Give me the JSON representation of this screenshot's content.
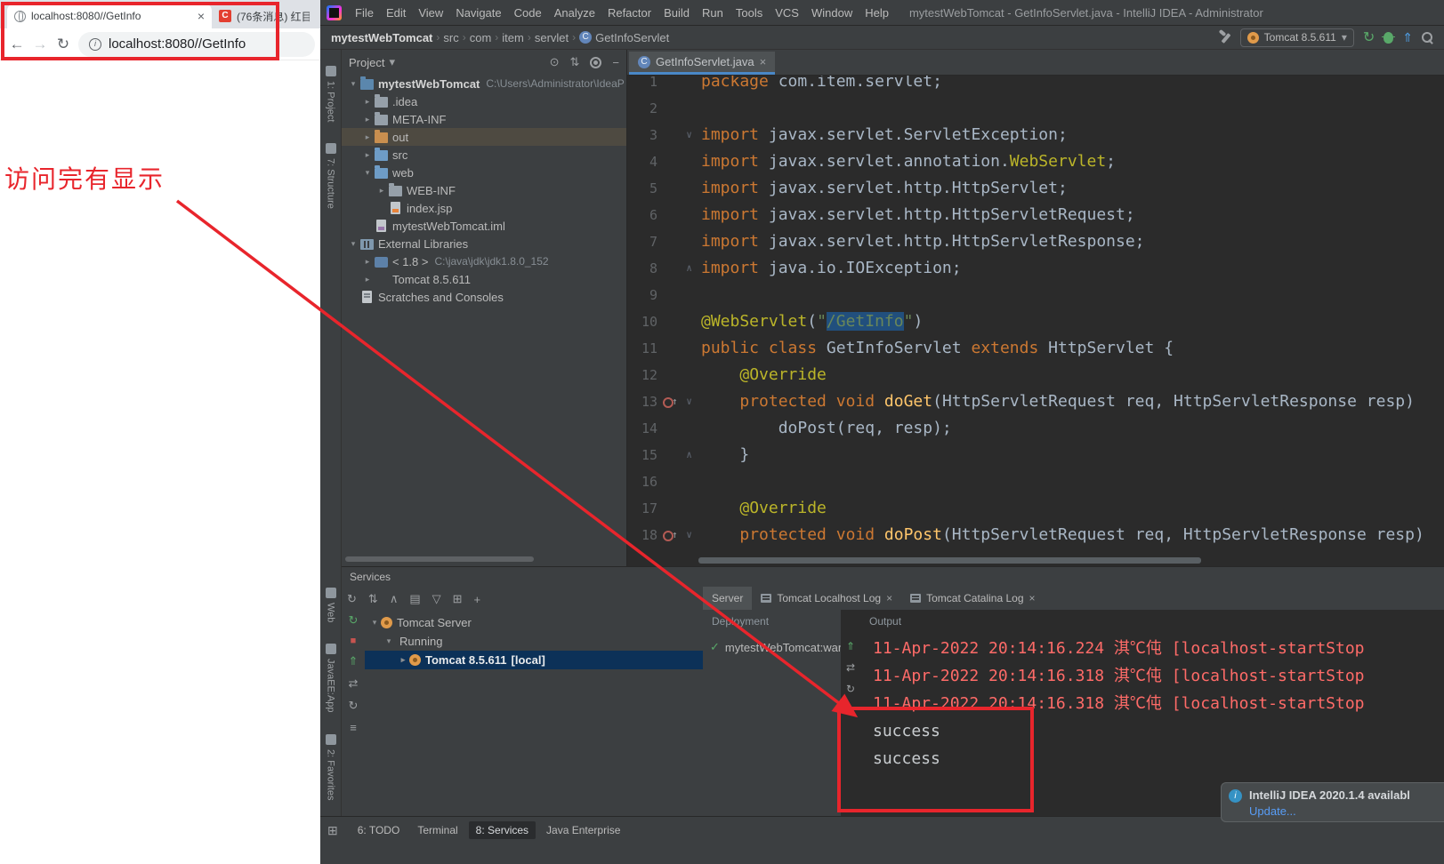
{
  "colors": {
    "annotation_red": "#e8252c",
    "selection_blue": "#214f7d",
    "log_error_red": "#ff6b68",
    "accent_tab_underline": "#4a88c7"
  },
  "annotations": {
    "note": "访问完有显示"
  },
  "browser": {
    "tabs": [
      {
        "title": "localhost:8080//GetInfo",
        "active": true
      },
      {
        "title": "(76条消息) 红目",
        "favicon_letter": "C",
        "active": false
      }
    ],
    "url": "localhost:8080//GetInfo"
  },
  "idea": {
    "window_title": "mytestWebTomcat - GetInfoServlet.java - IntelliJ IDEA - Administrator",
    "menus": [
      "File",
      "Edit",
      "View",
      "Navigate",
      "Code",
      "Analyze",
      "Refactor",
      "Build",
      "Run",
      "Tools",
      "VCS",
      "Window",
      "Help"
    ],
    "breadcrumbs": [
      "mytestWebTomcat",
      "src",
      "com",
      "item",
      "servlet",
      "GetInfoServlet"
    ],
    "run_config": "Tomcat 8.5.611",
    "tool_stripe": [
      {
        "id": "project",
        "label": "1: Project",
        "group": "top"
      },
      {
        "id": "structure",
        "label": "7: Structure",
        "group": "top"
      },
      {
        "id": "web",
        "label": "Web",
        "group": "bottom"
      },
      {
        "id": "javaee-app",
        "label": "JavaEE:App",
        "group": "bottom"
      },
      {
        "id": "favorites",
        "label": "2: Favorites",
        "group": "bottom"
      }
    ],
    "project": {
      "title": "Project",
      "tree": [
        {
          "label": "mytestWebTomcat",
          "path": "C:\\Users\\Administrator\\IdeaP",
          "arrow": "▾",
          "icon": "project",
          "bold": true,
          "indent": 0
        },
        {
          "label": ".idea",
          "arrow": "▸",
          "icon": "folder",
          "indent": 1
        },
        {
          "label": "META-INF",
          "arrow": "▸",
          "icon": "folder",
          "indent": 1
        },
        {
          "label": "out",
          "arrow": "▸",
          "icon": "folder-out",
          "indent": 1,
          "sel": true
        },
        {
          "label": "src",
          "arrow": "▸",
          "icon": "folder-src",
          "indent": 1
        },
        {
          "label": "web",
          "arrow": "▾",
          "icon": "folder-web",
          "indent": 1
        },
        {
          "label": "WEB-INF",
          "arrow": "▸",
          "icon": "folder",
          "indent": 2
        },
        {
          "label": "index.jsp",
          "icon": "jsp",
          "indent": 2
        },
        {
          "label": "mytestWebTomcat.iml",
          "icon": "iml",
          "indent": 1
        },
        {
          "label": "External Libraries",
          "arrow": "▾",
          "icon": "libs",
          "indent": 0
        },
        {
          "label": "< 1.8 >",
          "path": "C:\\java\\jdk\\jdk1.8.0_152",
          "arrow": "▸",
          "icon": "jdk",
          "indent": 1
        },
        {
          "label": "Tomcat 8.5.611",
          "arrow": "▸",
          "icon": "tomcat",
          "indent": 1
        },
        {
          "label": "Scratches and Consoles",
          "icon": "scratch",
          "indent": 0
        }
      ]
    },
    "editor": {
      "tab": "GetInfoServlet.java",
      "lines": [
        {
          "n": 1,
          "tokens": [
            [
              "k",
              "package"
            ],
            [
              "p",
              " com.item.servlet;"
            ]
          ]
        },
        {
          "n": 2,
          "tokens": []
        },
        {
          "n": 3,
          "fold": "v",
          "tokens": [
            [
              "k",
              "import"
            ],
            [
              "p",
              " javax.servlet.ServletException;"
            ]
          ]
        },
        {
          "n": 4,
          "tokens": [
            [
              "k",
              "import"
            ],
            [
              "p",
              " javax.servlet.annotation."
            ],
            [
              "a",
              "WebServlet"
            ],
            [
              "p",
              ";"
            ]
          ]
        },
        {
          "n": 5,
          "tokens": [
            [
              "k",
              "import"
            ],
            [
              "p",
              " javax.servlet.http.HttpServlet;"
            ]
          ]
        },
        {
          "n": 6,
          "tokens": [
            [
              "k",
              "import"
            ],
            [
              "p",
              " javax.servlet.http.HttpServletRequest;"
            ]
          ]
        },
        {
          "n": 7,
          "tokens": [
            [
              "k",
              "import"
            ],
            [
              "p",
              " javax.servlet.http.HttpServletResponse;"
            ]
          ]
        },
        {
          "n": 8,
          "fold": "c",
          "tokens": [
            [
              "k",
              "import"
            ],
            [
              "p",
              " java.io.IOException;"
            ]
          ]
        },
        {
          "n": 9,
          "tokens": []
        },
        {
          "n": 10,
          "tokens": [
            [
              "a",
              "@WebServlet"
            ],
            [
              "p",
              "("
            ],
            [
              "s",
              "\""
            ],
            [
              "ssel",
              "/GetInfo"
            ],
            [
              "s",
              "\""
            ],
            [
              "p",
              ")"
            ]
          ]
        },
        {
          "n": 11,
          "tokens": [
            [
              "k",
              "public class "
            ],
            [
              "p",
              "GetInfoServlet "
            ],
            [
              "k",
              "extends"
            ],
            [
              "p",
              " HttpServlet {"
            ]
          ]
        },
        {
          "n": 12,
          "tokens": [
            [
              "p",
              "    "
            ],
            [
              "a",
              "@Override"
            ]
          ]
        },
        {
          "n": 13,
          "fold": "v",
          "override": true,
          "tokens": [
            [
              "p",
              "    "
            ],
            [
              "k",
              "protected void "
            ],
            [
              "m",
              "doGet"
            ],
            [
              "p",
              "(HttpServletRequest req, HttpServletResponse resp)"
            ]
          ]
        },
        {
          "n": 14,
          "tokens": [
            [
              "p",
              "        doPost(req, resp);"
            ]
          ]
        },
        {
          "n": 15,
          "fold": "c",
          "tokens": [
            [
              "p",
              "    }"
            ]
          ]
        },
        {
          "n": 16,
          "tokens": []
        },
        {
          "n": 17,
          "tokens": [
            [
              "p",
              "    "
            ],
            [
              "a",
              "@Override"
            ]
          ]
        },
        {
          "n": 18,
          "fold": "v",
          "override": true,
          "tokens": [
            [
              "p",
              "    "
            ],
            [
              "k",
              "protected void "
            ],
            [
              "m",
              "doPost"
            ],
            [
              "p",
              "(HttpServletRequest req, HttpServletResponse resp)"
            ]
          ]
        }
      ]
    },
    "services": {
      "title": "Services",
      "tree": [
        {
          "label": "Tomcat Server",
          "arrow": "▾",
          "icon": "tomcat",
          "indent": 0
        },
        {
          "label": "Running",
          "arrow": "▾",
          "indent": 1
        },
        {
          "label": "Tomcat 8.5.611",
          "suffix": "[local]",
          "arrow": "▸",
          "icon": "tomcat",
          "indent": 2,
          "selected": true
        }
      ],
      "tabs": [
        {
          "label": "Server",
          "active": true
        },
        {
          "label": "Tomcat Localhost Log",
          "closable": true
        },
        {
          "label": "Tomcat Catalina Log",
          "closable": true
        }
      ],
      "deployment": {
        "header": "Deployment",
        "item": "mytestWebTomcat:war"
      },
      "output": {
        "header": "Output",
        "lines": [
          {
            "text": "11-Apr-2022 20:14:16.224 淇℃伅 [localhost-startStop",
            "kind": "error"
          },
          {
            "text": "11-Apr-2022 20:14:16.318 淇℃伅 [localhost-startStop",
            "kind": "error"
          },
          {
            "text": "11-Apr-2022 20:14:16.318 淇℃伅 [localhost-startStop",
            "kind": "error"
          },
          {
            "text": "success",
            "kind": "plain"
          },
          {
            "text": "success",
            "kind": "plain"
          }
        ]
      }
    },
    "status_bar": {
      "items": [
        {
          "label": "6: TODO"
        },
        {
          "label": "Terminal"
        },
        {
          "label": "8: Services",
          "active": true
        },
        {
          "label": "Java Enterprise"
        }
      ]
    },
    "notification": {
      "title": "IntelliJ IDEA 2020.1.4 availabl",
      "action": "Update..."
    }
  }
}
